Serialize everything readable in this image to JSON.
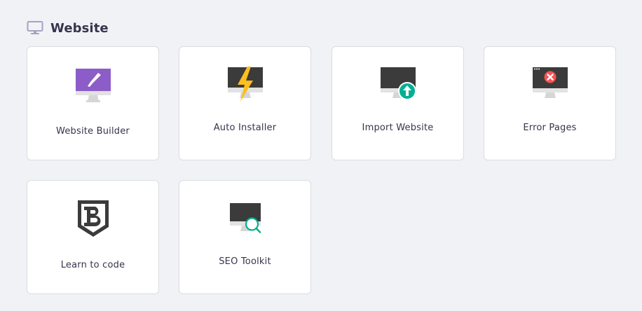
{
  "section": {
    "title": "Website",
    "icon": "monitor-icon"
  },
  "cards": [
    {
      "label": "Website Builder",
      "icon": "website-builder-icon"
    },
    {
      "label": "Auto Installer",
      "icon": "auto-installer-icon"
    },
    {
      "label": "Import Website",
      "icon": "import-website-icon"
    },
    {
      "label": "Error Pages",
      "icon": "error-pages-icon"
    },
    {
      "label": "Learn to code",
      "icon": "learn-to-code-icon"
    },
    {
      "label": "SEO Toolkit",
      "icon": "seo-toolkit-icon"
    }
  ],
  "colors": {
    "background": "#f1f2f6",
    "card_border": "#dadce0",
    "text": "#36344d",
    "accent_purple": "#8c5cc8",
    "accent_yellow": "#fdbf1e",
    "accent_green": "#00b090",
    "accent_red": "#fc5151",
    "monitor_dark": "#3b3b3b",
    "monitor_stand": "#dedede"
  }
}
